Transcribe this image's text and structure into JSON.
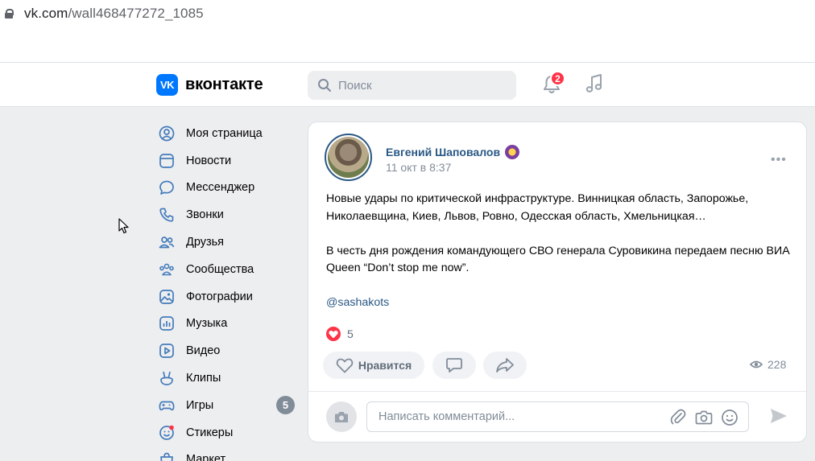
{
  "browser": {
    "url_host": "vk.com",
    "url_path": "/wall468477272_1085"
  },
  "header": {
    "logo_mark": "VK",
    "logo_text": "вконтакте",
    "search_placeholder": "Поиск",
    "notifications_count": "2"
  },
  "sidebar": {
    "items": [
      {
        "label": "Моя страница",
        "icon": "profile-icon"
      },
      {
        "label": "Новости",
        "icon": "news-icon"
      },
      {
        "label": "Мессенджер",
        "icon": "messenger-icon"
      },
      {
        "label": "Звонки",
        "icon": "phone-icon"
      },
      {
        "label": "Друзья",
        "icon": "friends-icon"
      },
      {
        "label": "Сообщества",
        "icon": "communities-icon"
      },
      {
        "label": "Фотографии",
        "icon": "photos-icon"
      },
      {
        "label": "Музыка",
        "icon": "music-icon"
      },
      {
        "label": "Видео",
        "icon": "video-icon"
      },
      {
        "label": "Клипы",
        "icon": "clips-icon"
      },
      {
        "label": "Игры",
        "icon": "games-icon",
        "count": "5"
      },
      {
        "label": "Стикеры",
        "icon": "stickers-icon"
      },
      {
        "label": "Маркет",
        "icon": "market-icon"
      }
    ]
  },
  "post": {
    "author": "Евгений Шаповалов",
    "date": "11 окт в 8:37",
    "paragraph1": "Новые удары по критической инфраструктуре. Винницкая область, Запорожье, Николаевщина, Киев, Львов, Ровно, Одесская область, Хмельницкая…",
    "paragraph2": "В честь дня рождения командующего СВО генерала Суровикина передаем песню ВИА Queen “Don’t stop me now”.",
    "mention": "@sashakots",
    "likes_count": "5",
    "like_label": "Нравится",
    "views_count": "228",
    "comment_placeholder": "Написать комментарий..."
  },
  "colors": {
    "accent": "#0077ff",
    "link": "#2a5885",
    "badge": "#ff3347",
    "muted": "#818c99",
    "page_bg": "#edeef0"
  }
}
